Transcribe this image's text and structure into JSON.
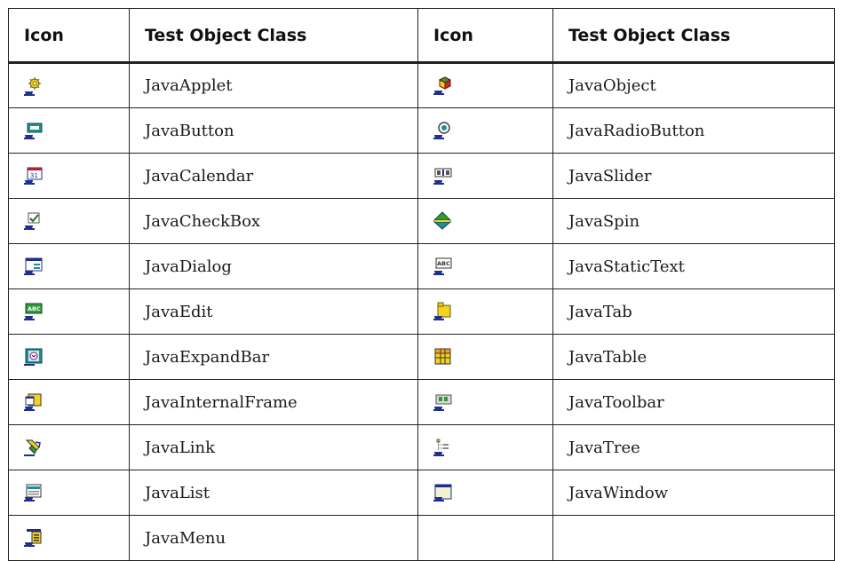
{
  "headers": [
    "Icon",
    "Test Object Class",
    "Icon",
    "Test Object Class"
  ],
  "rows": [
    {
      "left": {
        "icon": "java-applet-icon",
        "label": "JavaApplet"
      },
      "right": {
        "icon": "java-object-icon",
        "label": "JavaObject"
      }
    },
    {
      "left": {
        "icon": "java-button-icon",
        "label": "JavaButton"
      },
      "right": {
        "icon": "java-radio-button-icon",
        "label": "JavaRadioButton"
      }
    },
    {
      "left": {
        "icon": "java-calendar-icon",
        "label": "JavaCalendar"
      },
      "right": {
        "icon": "java-slider-icon",
        "label": "JavaSlider"
      }
    },
    {
      "left": {
        "icon": "java-checkbox-icon",
        "label": "JavaCheckBox"
      },
      "right": {
        "icon": "java-spin-icon",
        "label": "JavaSpin"
      }
    },
    {
      "left": {
        "icon": "java-dialog-icon",
        "label": "JavaDialog"
      },
      "right": {
        "icon": "java-static-text-icon",
        "label": "JavaStaticText"
      }
    },
    {
      "left": {
        "icon": "java-edit-icon",
        "label": "JavaEdit"
      },
      "right": {
        "icon": "java-tab-icon",
        "label": "JavaTab"
      }
    },
    {
      "left": {
        "icon": "java-expand-bar-icon",
        "label": "JavaExpandBar"
      },
      "right": {
        "icon": "java-table-icon",
        "label": "JavaTable"
      }
    },
    {
      "left": {
        "icon": "java-internal-frame-icon",
        "label": "JavaInternalFrame"
      },
      "right": {
        "icon": "java-toolbar-icon",
        "label": "JavaToolbar"
      }
    },
    {
      "left": {
        "icon": "java-link-icon",
        "label": "JavaLink"
      },
      "right": {
        "icon": "java-tree-icon",
        "label": "JavaTree"
      }
    },
    {
      "left": {
        "icon": "java-list-icon",
        "label": "JavaList"
      },
      "right": {
        "icon": "java-window-icon",
        "label": "JavaWindow"
      }
    },
    {
      "left": {
        "icon": "java-menu-icon",
        "label": "JavaMenu"
      },
      "right": {
        "icon": "",
        "label": ""
      }
    }
  ],
  "colors": {
    "border": "#222222",
    "cup": "#1f2f8f",
    "yellow": "#f2d21a",
    "green": "#2e9b3a",
    "red": "#d22222",
    "teal": "#1f8f8f"
  }
}
